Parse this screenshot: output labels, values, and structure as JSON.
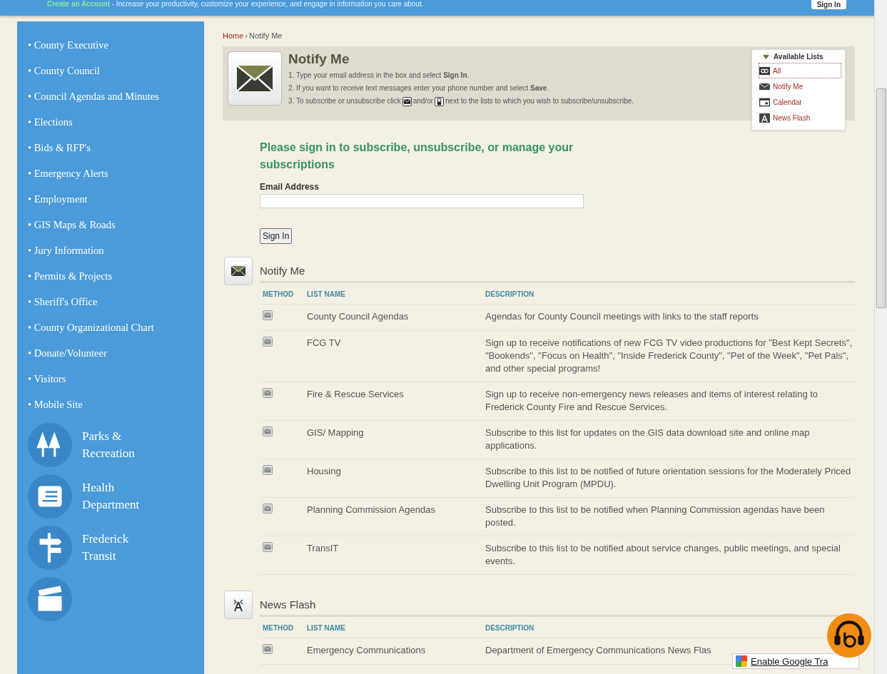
{
  "top_bar": {
    "link": "Create an Account",
    "text": "- Increase your productivity, customize your experience, and engage in information you care about.",
    "button": "Sign In"
  },
  "sidebar": {
    "links": [
      "• County Executive",
      "• County Council",
      "• Council Agendas and Minutes",
      "• Elections",
      "• Bids & RFP's",
      "• Emergency Alerts",
      "• Employment",
      "• GIS Maps & Roads",
      "• Jury Information",
      "• Permits & Projects",
      "• Sheriff's Office",
      "• County Organizational Chart",
      "• Donate/Volunteer",
      "• Visitors",
      "• Mobile Site"
    ],
    "departments": [
      {
        "label": "Parks & Recreation",
        "kind": "trees"
      },
      {
        "label": "Health Department",
        "kind": "clipboard"
      },
      {
        "label": "Frederick Transit",
        "kind": "signpost"
      },
      {
        "kind": "film"
      }
    ]
  },
  "breadcrumb": {
    "home": "Home",
    "separator": "›",
    "current": "Notify Me"
  },
  "header": {
    "title": "Notify Me",
    "steps": [
      "1. Type your email address in the box and select **Sign In**.",
      "2. If you want to receive text messages enter your phone number and select **Save**."
    ],
    "step3_start": "3. To subscribe or unsubscribe click",
    "step3_middle": "and/or",
    "step3_end": "next to the lists to which you wish to subscribe/unsubscribe."
  },
  "available_lists": {
    "title": "Available Lists",
    "items": [
      {
        "label": "All",
        "kind": "all",
        "selected": true
      },
      {
        "label": "Notify Me",
        "kind": "envelope",
        "selected": false
      },
      {
        "label": "Calendar",
        "kind": "calendar",
        "selected": false
      },
      {
        "label": "News Flash",
        "kind": "tower",
        "selected": false
      }
    ]
  },
  "signin": {
    "heading": "Please sign in to subscribe, unsubscribe, or manage your subscriptions",
    "email_label": "Email Address",
    "button": "Sign In"
  },
  "sections": [
    {
      "title": "Notify Me",
      "kind": "envelope",
      "columns": [
        "METHOD",
        "LIST NAME",
        "DESCRIPTION"
      ],
      "rows": [
        {
          "name": "County Council Agendas",
          "description": "Agendas for County Council meetings with links to the staff reports"
        },
        {
          "name": "FCG TV",
          "description": "Sign up to receive notifications of new FCG TV video productions for \"Best Kept Secrets\", \"Bookends\", \"Focus on Health\", \"Inside Frederick County\", \"Pet of the Week\", \"Pet Pals\", and other special programs!"
        },
        {
          "name": "Fire & Rescue Services",
          "description": "Sign up to receive non-emergency news releases and items of interest relating to Frederick County Fire and Rescue Services."
        },
        {
          "name": "GIS/ Mapping",
          "description": "Subscribe to this list for updates on the GIS data download site and online map applications."
        },
        {
          "name": "Housing",
          "description": "Subscribe to this list to be notified of future orientation sessions for the Moderately Priced Dwelling Unit Program (MPDU)."
        },
        {
          "name": "Planning Commission Agendas",
          "description": "Subscribe to this list to be notified when Planning Commission agendas have been posted."
        },
        {
          "name": "TransIT",
          "description": "Subscribe to this list to be notified about service changes, public meetings, and special events."
        }
      ]
    },
    {
      "title": "News Flash",
      "kind": "tower",
      "columns": [
        "METHOD",
        "LIST NAME",
        "DESCRIPTION"
      ],
      "rows": [
        {
          "name": "Emergency Communications",
          "description": "Department of Emergency Communications News Flas"
        }
      ]
    }
  ],
  "translate": {
    "label": "Enable Google Tra"
  }
}
